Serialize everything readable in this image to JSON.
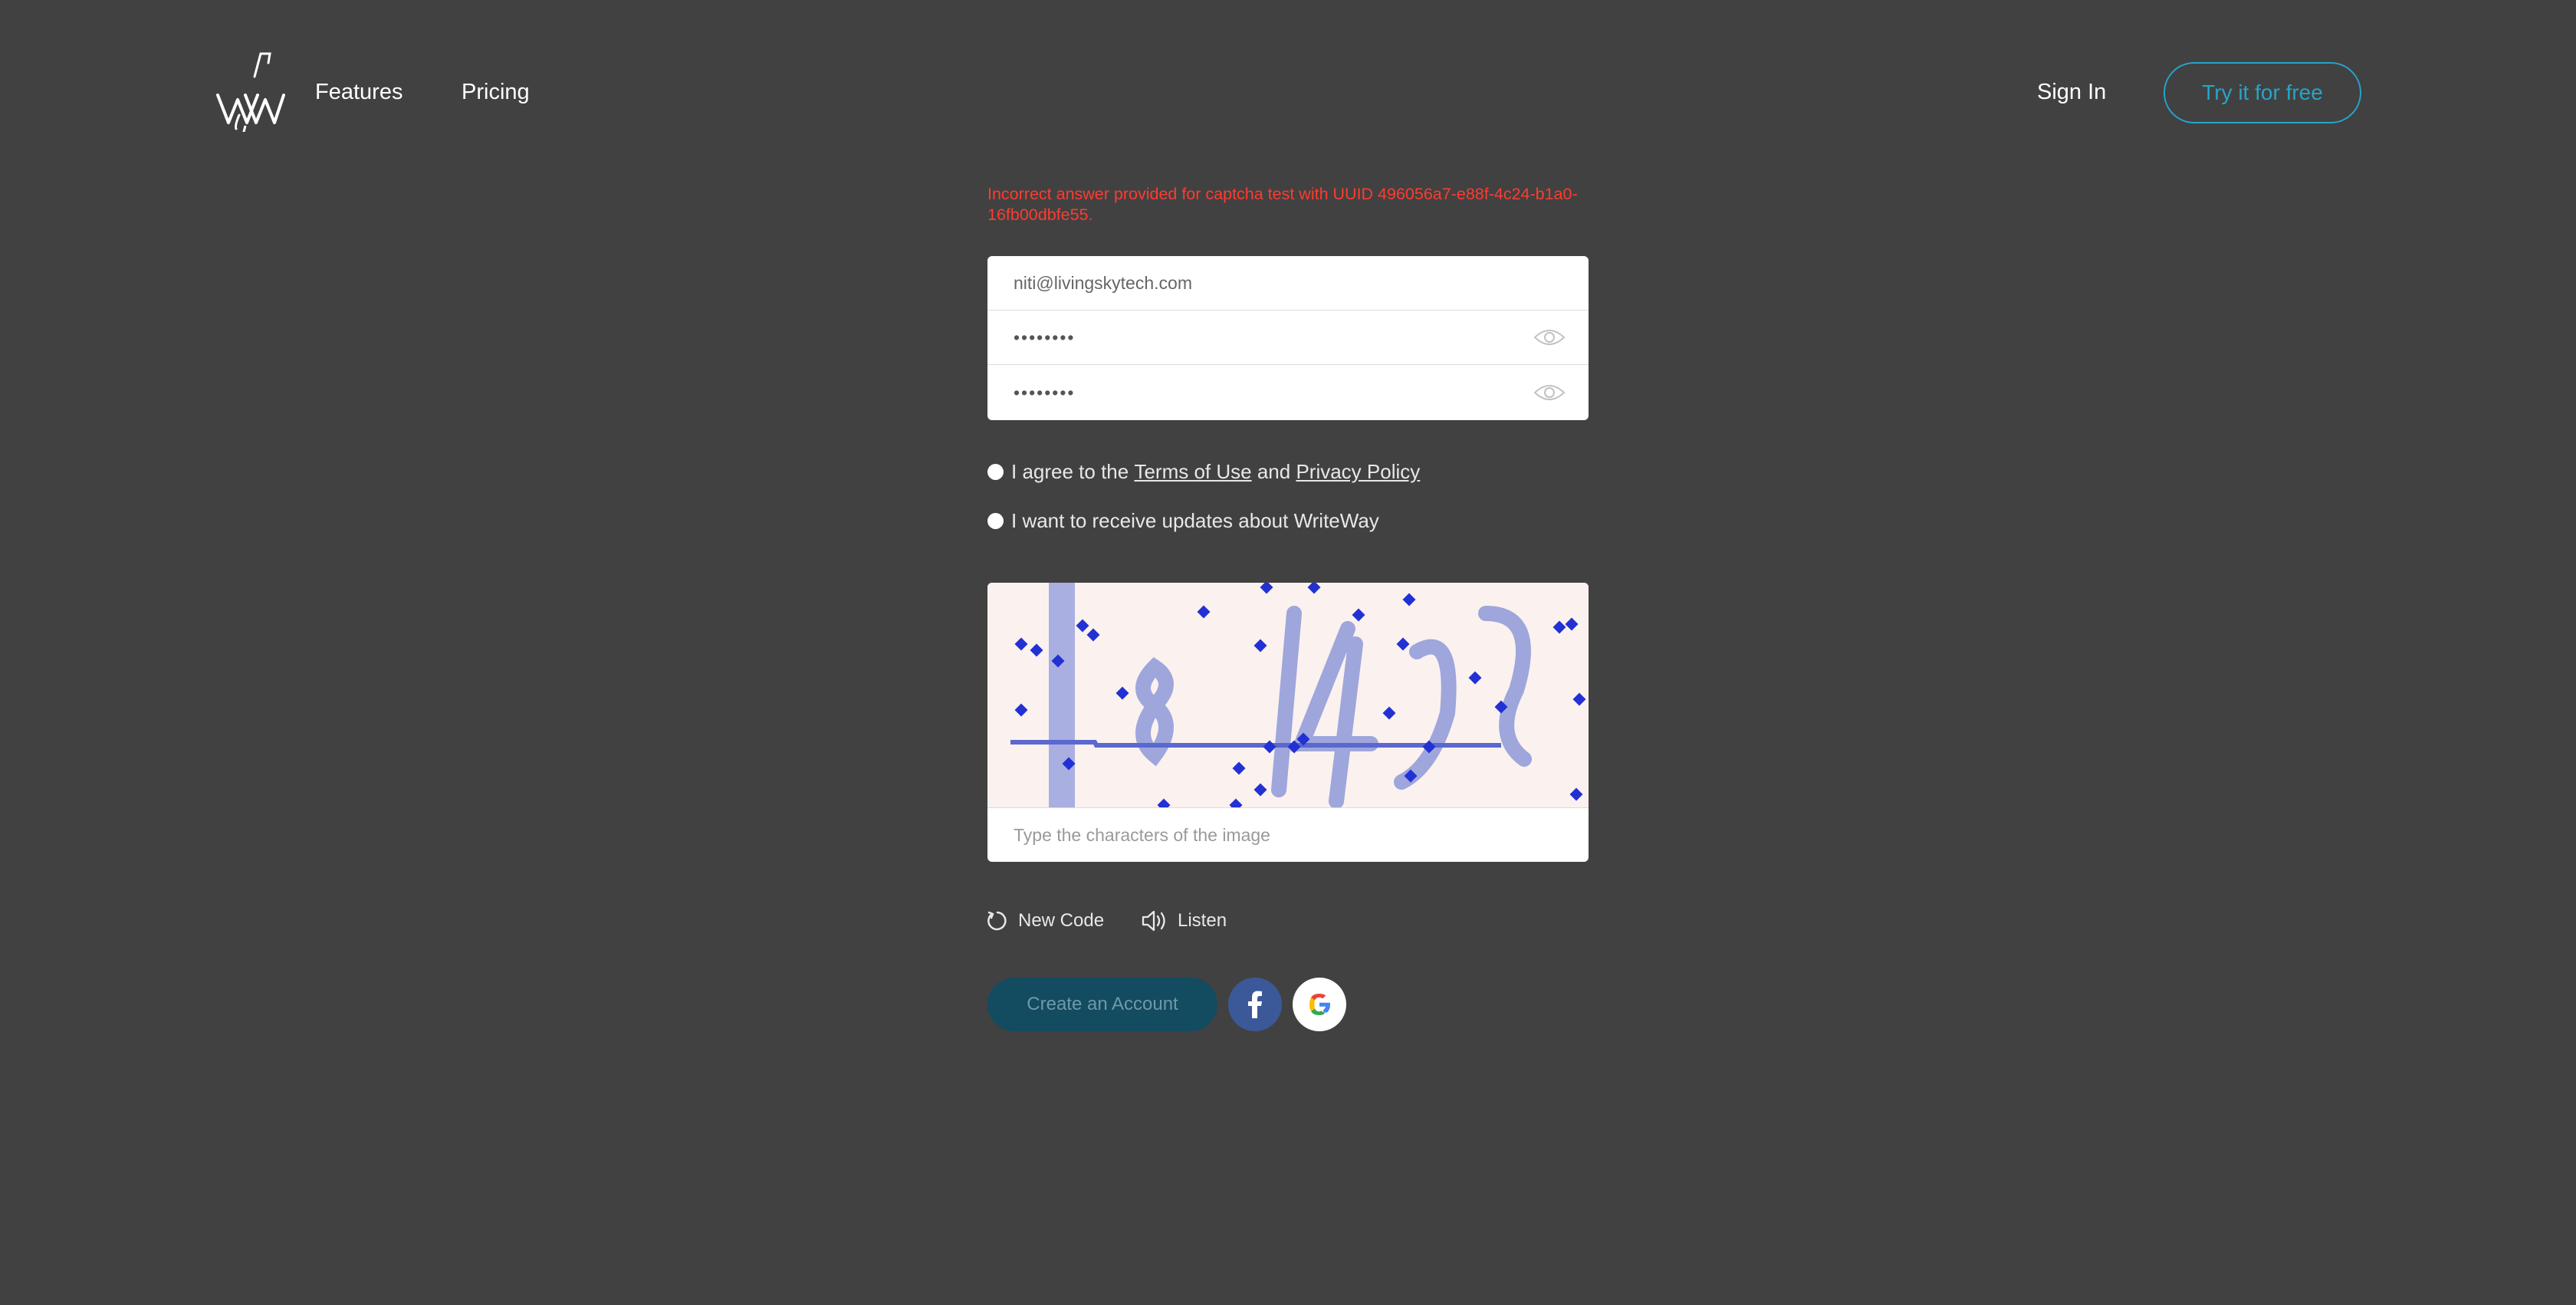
{
  "header": {
    "logo_icon": "writeway-logo",
    "nav": [
      {
        "label": "Features"
      },
      {
        "label": "Pricing"
      }
    ],
    "sign_in_label": "Sign In",
    "try_label": "Try it for free"
  },
  "error_message": "Incorrect answer provided for captcha test with UUID 496056a7-e88f-4c24-b1a0-16fb00dbfe55.",
  "form": {
    "email_value": "niti@livingskytech.com",
    "password_value": "••••••••",
    "confirm_password_value": "••••••••",
    "terms": {
      "prefix": "I agree to the ",
      "terms_link": "Terms of Use",
      "and_text": " and ",
      "privacy_link": "Privacy Policy"
    },
    "updates_label": "I want to receive updates about WriteWay",
    "captcha_placeholder": "Type the characters of the image",
    "new_code_label": "New Code",
    "listen_label": "Listen",
    "create_label": "Create an Account"
  },
  "colors": {
    "background": "#414141",
    "accent": "#25a5c9",
    "error": "#ff3b30",
    "create_button": "#134b60",
    "facebook": "#3b5998"
  }
}
